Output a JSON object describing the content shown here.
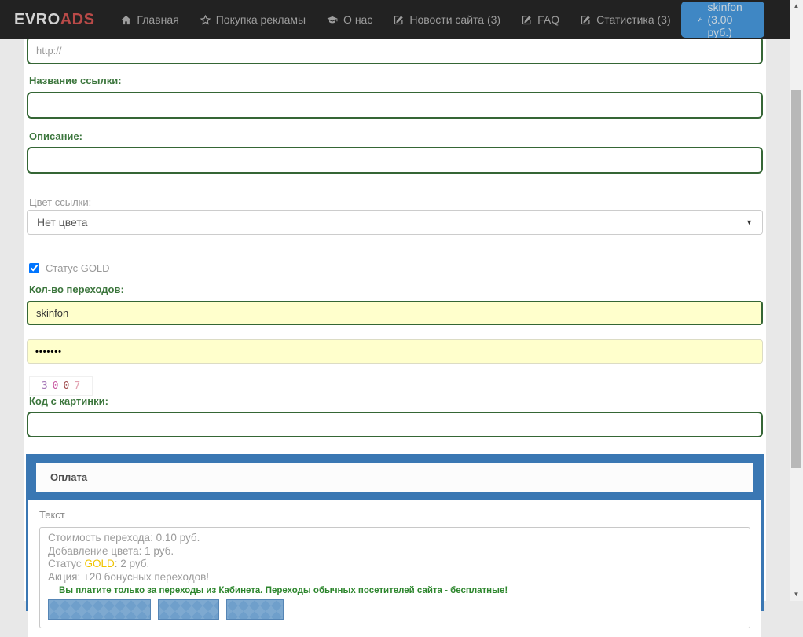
{
  "navbar": {
    "brand": {
      "part1": "EVRO",
      "part2": "ADS"
    },
    "items": [
      {
        "label": "Главная",
        "icon": "home-icon"
      },
      {
        "label": "Покупка рекламы",
        "icon": "star-icon"
      },
      {
        "label": "О нас",
        "icon": "graduation-cap-icon"
      },
      {
        "label": "Новости сайта (3)",
        "icon": "edit-icon"
      },
      {
        "label": "FAQ",
        "icon": "edit-icon"
      },
      {
        "label": "Статистика (3)",
        "icon": "edit-icon"
      }
    ],
    "user_button": {
      "label": "skinfon (3.00 руб.)",
      "icon": "wrench-icon"
    }
  },
  "form": {
    "url_field": {
      "placeholder": "http://"
    },
    "link_name": {
      "label": "Название ссылки:",
      "value": ""
    },
    "description": {
      "label": "Описание:",
      "value": ""
    },
    "link_color": {
      "label": "Цвет ссылки:",
      "selected": "Нет цвета"
    },
    "gold_status": {
      "label": "Статус GOLD",
      "checked": true
    },
    "transitions": {
      "label": "Кол-во переходов:",
      "value": "skinfon"
    },
    "password": {
      "value": "•••••••"
    },
    "captcha": {
      "digits": [
        "3",
        "0",
        "0",
        "7"
      ],
      "digit_colors": [
        "#a678b8",
        "#c957a2",
        "#a04b4b",
        "#e2a1b0"
      ]
    },
    "captcha_code": {
      "label": "Код с картинки:",
      "value": ""
    }
  },
  "payment_panel": {
    "title": "Оплата",
    "body_label": "Текст",
    "pricing_lines": [
      "Стоимость перехода: 0.10 руб.",
      "Добавление цвета: 1 руб.",
      "Акция: +20 бонусных переходов!"
    ],
    "gold_line": {
      "prefix": "Статус ",
      "gold": "GOLD",
      "suffix": ": 2 руб."
    },
    "notice": "Вы платите только за переходы из Кабинета. Переходы обычных посетителей сайта - бесплатные!"
  },
  "colors": {
    "accent_blue": "#3a77b3",
    "nav_active_blue": "#3f87c4",
    "gold": "#f0c400",
    "label_green": "#3c763d",
    "field_yellow": "#ffffcc",
    "notice_green": "#2d862d"
  }
}
